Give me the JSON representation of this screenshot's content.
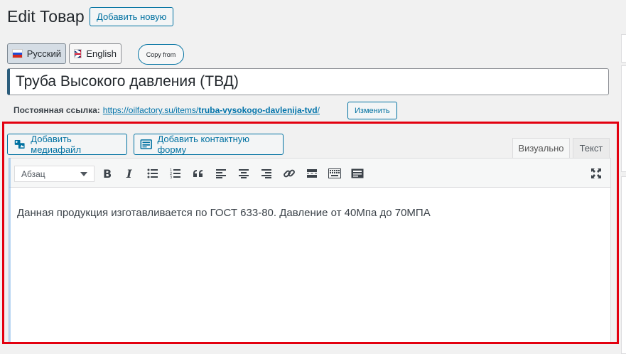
{
  "header": {
    "title": "Edit Товар",
    "add_new_label": "Добавить новую"
  },
  "languages": {
    "tabs": [
      {
        "label": "Русский",
        "flag": "ru-flag-icon",
        "active": true
      },
      {
        "label": "English",
        "flag": "uk-flag-icon",
        "active": false
      }
    ],
    "copy_from_label": "Copy from"
  },
  "post": {
    "title_value": "Труба Высокого давления (ТВД)",
    "permalink_label": "Постоянная ссылка:",
    "permalink_base": "https://oilfactory.su/items/",
    "permalink_slug": "truba-vysokogo-davlenija-tvd",
    "permalink_trailing": "/",
    "edit_slug_label": "Изменить"
  },
  "editor": {
    "add_media_label": "Добавить медиафайл",
    "add_form_label": "Добавить контактную форму",
    "tab_visual": "Визуально",
    "tab_text": "Текст",
    "format_select_value": "Абзац",
    "toolbar_icons": [
      "bold-icon",
      "italic-icon",
      "bullet-list-icon",
      "numbered-list-icon",
      "blockquote-icon",
      "align-left-icon",
      "align-center-icon",
      "align-right-icon",
      "link-icon",
      "read-more-icon",
      "toolbar-toggle-icon",
      "form-icon",
      "fullscreen-icon"
    ],
    "content_text": "Данная продукция изготавливается по ГОСТ 633-80. Давление от 40Мпа до 70МПА"
  },
  "colors": {
    "accent": "#0071a1",
    "highlight_frame": "#e3000f",
    "background": "#f1f1f1"
  }
}
